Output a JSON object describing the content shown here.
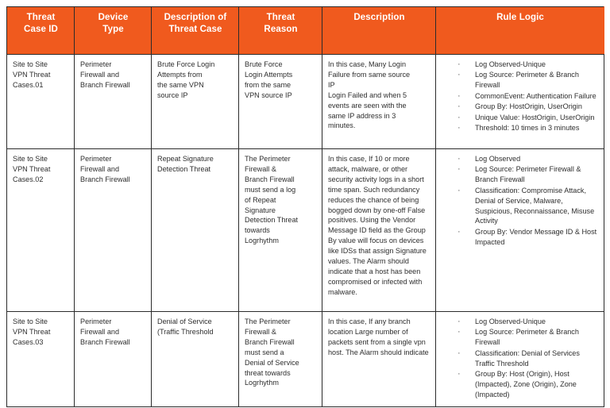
{
  "theme": {
    "header_bg": "#F05A1E",
    "header_text": "#FFFFFF",
    "border": "#2B2B2B",
    "body_text": "#2E2E2E"
  },
  "table": {
    "columns": [
      {
        "label": "Threat\nCase ID"
      },
      {
        "label": "Device\nType"
      },
      {
        "label": "Description of\nThreat Case"
      },
      {
        "label": "Threat\nReason"
      },
      {
        "label": "Description"
      },
      {
        "label": "Rule Logic"
      }
    ],
    "rows": [
      {
        "threat_case_id": "Site to Site\nVPN  Threat\nCases.01",
        "device_type": "Perimeter\nFirewall and\nBranch Firewall",
        "description_of_threat_case": "Brute Force Login\nAttempts from\nthe same VPN\nsource IP",
        "threat_reason": "Brute Force\nLogin Attempts\nfrom the same\nVPN source IP",
        "description": "In this case, Many Login\nFailure from same source\nIP\nLogin Failed and when 5\nevents are seen with the\nsame IP address in 3\nminutes.",
        "rule_logic": [
          "Log Observed-Unique",
          "Log Source: Perimeter & Branch Firewall",
          "CommonEvent: Authentication Failure",
          "Group By: HostOrigin, UserOrigin",
          "Unique Value: HostOrigin, UserOrigin",
          "Threshold: 10 times in 3 minutes"
        ]
      },
      {
        "threat_case_id": "Site to Site\nVPN  Threat\nCases.02",
        "device_type": "Perimeter\nFirewall and\nBranch Firewall",
        "description_of_threat_case": "Repeat Signature\nDetection Threat",
        "threat_reason": "The Perimeter\nFirewall &\nBranch Firewall\nmust send a log\nof Repeat\nSignature\nDetection Threat\ntowards\nLogrhythm",
        "description": "In this case, If 10 or more attack, malware, or other security activity logs in a short time span. Such redundancy reduces the chance of being bogged down by one-off False positives. Using the Vendor Message ID field as the Group By value will focus on devices like IDSs that assign Signature values. The Alarm should indicate that a host has been compromised or infected with malware.",
        "rule_logic": [
          "Log Observed",
          "Log Source: Perimeter Firewall & Branch Firewall",
          "Classification: Compromise Attack, Denial of Service, Malware, Suspicious, Reconnaissance, Misuse Activity",
          "Group By: Vendor Message ID & Host Impacted"
        ]
      },
      {
        "threat_case_id": "Site to Site\nVPN  Threat\nCases.03",
        "device_type": "Perimeter\nFirewall and\nBranch Firewall",
        "description_of_threat_case": "Denial of Service\n(Traffic Threshold",
        "threat_reason": "The Perimeter\nFirewall &\nBranch Firewall\nmust send a\nDenial of Service\nthreat towards\nLogrhythm",
        "description": "In this case, If any branch location Large number of packets sent from a single vpn host. The Alarm should indicate",
        "rule_logic": [
          "Log Observed-Unique",
          "Log Source: Perimeter & Branch Firewall",
          "Classification: Denial of Services Traffic Threshold",
          "Group By: Host (Origin), Host (Impacted), Zone (Origin), Zone (Impacted)"
        ]
      }
    ]
  }
}
